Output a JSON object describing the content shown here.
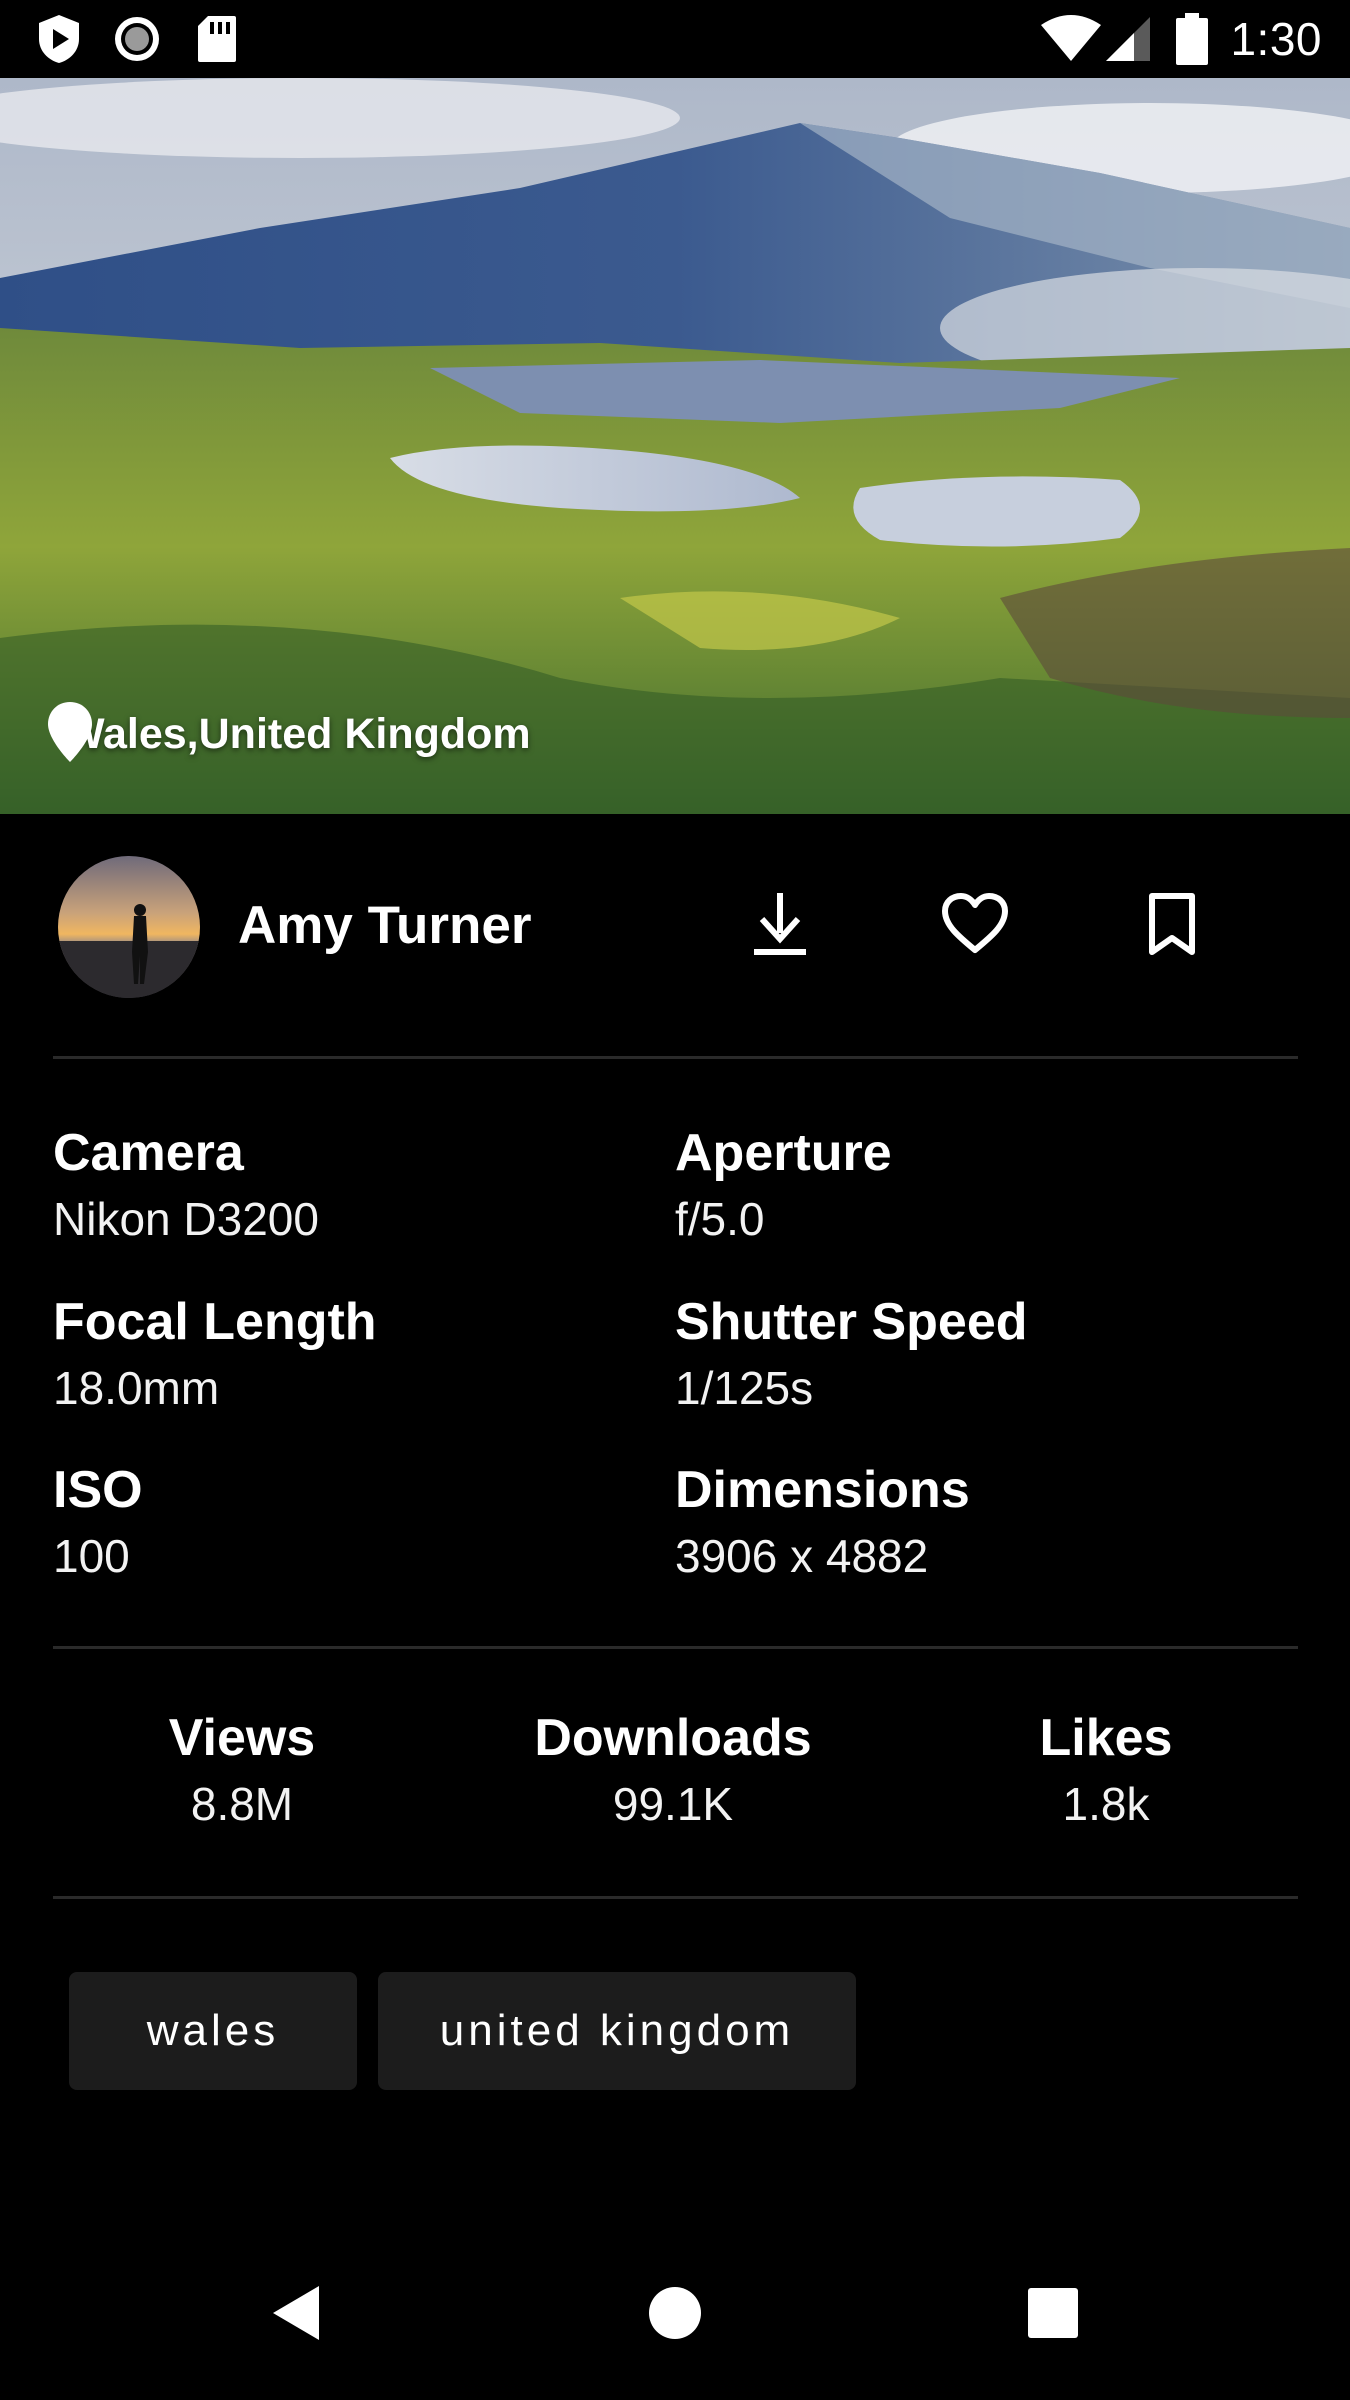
{
  "status_bar": {
    "time": "1:30",
    "icons": [
      "play-protect-icon",
      "record-icon",
      "sd-card-icon",
      "wifi-icon",
      "cellular-signal-icon",
      "battery-icon"
    ]
  },
  "photo": {
    "location": "Wales,United Kingdom"
  },
  "author": {
    "name": "Amy Turner"
  },
  "actions": [
    "download-icon",
    "heart-icon",
    "bookmark-icon"
  ],
  "exif": [
    {
      "label": "Camera",
      "value": "Nikon D3200"
    },
    {
      "label": "Aperture",
      "value": "f/5.0"
    },
    {
      "label": "Focal Length",
      "value": "18.0mm"
    },
    {
      "label": "Shutter Speed",
      "value": "1/125s"
    },
    {
      "label": "ISO",
      "value": "100"
    },
    {
      "label": "Dimensions",
      "value": "3906 x 4882"
    }
  ],
  "stats": [
    {
      "label": "Views",
      "value": "8.8M"
    },
    {
      "label": "Downloads",
      "value": "99.1K"
    },
    {
      "label": "Likes",
      "value": "1.8k"
    }
  ],
  "tags": [
    "wales",
    "united kingdom"
  ],
  "nav": [
    "back-icon",
    "home-icon",
    "recents-icon"
  ]
}
